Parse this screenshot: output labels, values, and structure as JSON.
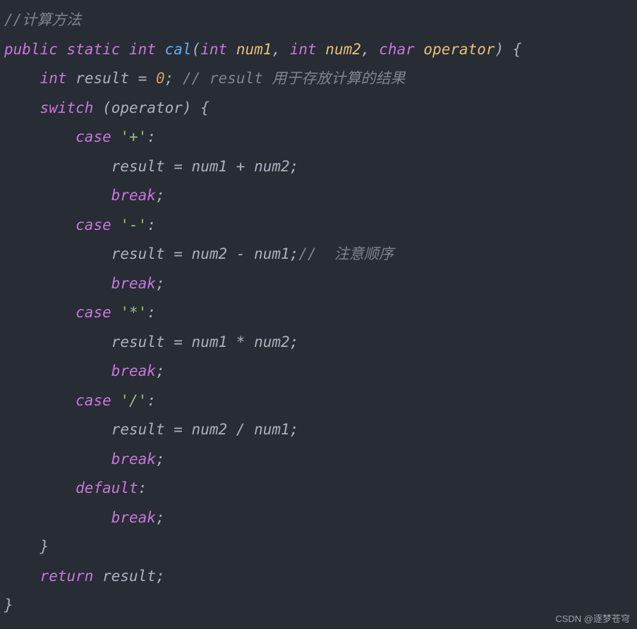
{
  "code": {
    "l1_comment": "//计算方法",
    "l2_kw_public": "public",
    "l2_kw_static": "static",
    "l2_type_int": "int",
    "l2_func": "cal",
    "l2_p_open": "(",
    "l2_type_int_p1": "int",
    "l2_p1": "num1",
    "l2_comma1": ",",
    "l2_type_int_p2": "int",
    "l2_p2": "num2",
    "l2_comma2": ",",
    "l2_type_char": "char",
    "l2_p3": "operator",
    "l2_p_close": ")",
    "l2_brace_open": "{",
    "l3_type_int": "int",
    "l3_ident": "result",
    "l3_eq": "=",
    "l3_zero": "0",
    "l3_semi": ";",
    "l3_comment": "// result 用于存放计算的结果",
    "l4_switch": "switch",
    "l4_p_open": "(",
    "l4_expr": "operator",
    "l4_p_close": ")",
    "l4_brace_open": "{",
    "l5_case": "case",
    "l5_lit": "'+'",
    "l5_colon": ":",
    "l6_lhs": "result",
    "l6_eq": "=",
    "l6_a": "num1",
    "l6_op": "+",
    "l6_b": "num2",
    "l6_semi": ";",
    "l7_break": "break",
    "l7_semi": ";",
    "l8_case": "case",
    "l8_lit": "'-'",
    "l8_colon": ":",
    "l9_lhs": "result",
    "l9_eq": "=",
    "l9_a": "num2",
    "l9_op": "-",
    "l9_b": "num1",
    "l9_semi": ";",
    "l9_comment": "//  注意顺序",
    "l10_break": "break",
    "l10_semi": ";",
    "l11_case": "case",
    "l11_lit": "'*'",
    "l11_colon": ":",
    "l12_lhs": "result",
    "l12_eq": "=",
    "l12_a": "num1",
    "l12_op": "*",
    "l12_b": "num2",
    "l12_semi": ";",
    "l13_break": "break",
    "l13_semi": ";",
    "l14_case": "case",
    "l14_lit": "'/'",
    "l14_colon": ":",
    "l15_lhs": "result",
    "l15_eq": "=",
    "l15_a": "num2",
    "l15_op": "/",
    "l15_b": "num1",
    "l15_semi": ";",
    "l16_break": "break",
    "l16_semi": ";",
    "l17_default": "default",
    "l17_colon": ":",
    "l18_break": "break",
    "l18_semi": ";",
    "l19_brace_close": "}",
    "l20_return": "return",
    "l20_ident": "result",
    "l20_semi": ";",
    "l21_brace_close": "}"
  },
  "watermark": "CSDN @逐梦苍穹"
}
